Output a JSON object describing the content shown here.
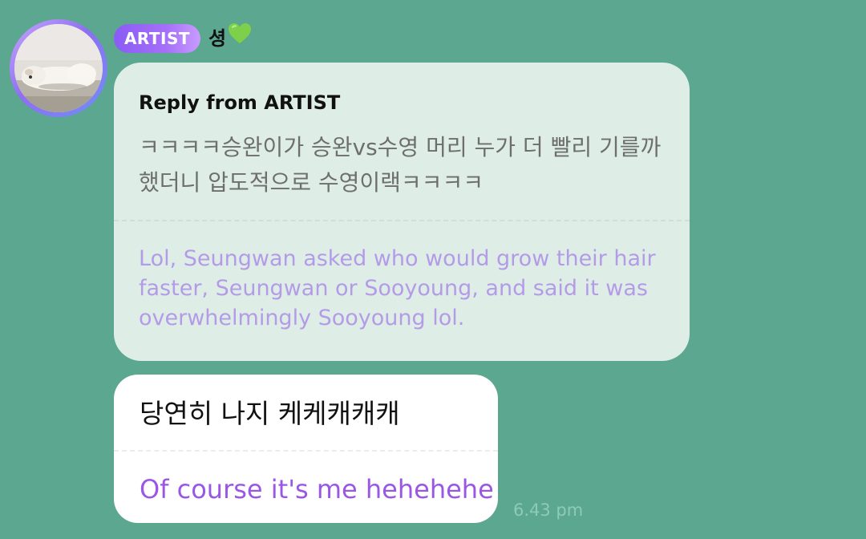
{
  "avatar": {
    "icon": "sleeping-dog-photo"
  },
  "header": {
    "badge_label": "ARTIST",
    "sender_name": "셩",
    "heart_icon": "green-heart-icon",
    "heart_color": "#7ed04a"
  },
  "reply": {
    "header": "Reply from ARTIST",
    "original_text": "ㅋㅋㅋㅋ승완이가 승완vs수영 머리 누가 더 빨리 기를까 했더니 압도적으로 수영이랙ㅋㅋㅋㅋ",
    "translation": "Lol, Seungwan asked who would grow their hair faster, Seungwan or Sooyoung, and said it was overwhelmingly Sooyoung lol."
  },
  "message": {
    "original_text": "당연히 나지 케케캐캐캐",
    "translation": "Of course it's me hehehehe",
    "timestamp": "6.43 pm"
  },
  "colors": {
    "background": "#5ba78f",
    "reply_bubble": "#deeee6",
    "message_bubble": "#ffffff",
    "badge": "#8a5cf6",
    "translation_text": "#9a57e6"
  }
}
